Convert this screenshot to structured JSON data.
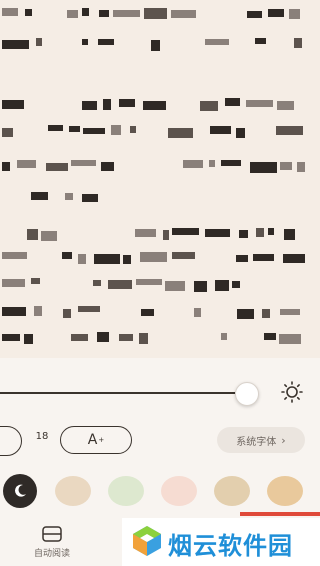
{
  "reader": {
    "content_obscured": true
  },
  "settings": {
    "brightness_level": 0.77,
    "font_size_value": "18",
    "font_increase_label": "A",
    "font_increase_sup": "+",
    "font_face_label": "系统字体",
    "font_face_chevron": "›",
    "themes": [
      {
        "name": "night",
        "color": "#2f2a27"
      },
      {
        "name": "sand",
        "color": "#ead8c1"
      },
      {
        "name": "green",
        "color": "#dde8cf"
      },
      {
        "name": "pink",
        "color": "#f6dcd2"
      },
      {
        "name": "tan",
        "color": "#e3cfae"
      },
      {
        "name": "amber",
        "color": "#e9c99c"
      }
    ],
    "auto_read_label": "自动阅读"
  },
  "watermark": {
    "text": "烟云软件园",
    "accent": "#e04a3a",
    "brand_color": "#1f8fd8"
  }
}
